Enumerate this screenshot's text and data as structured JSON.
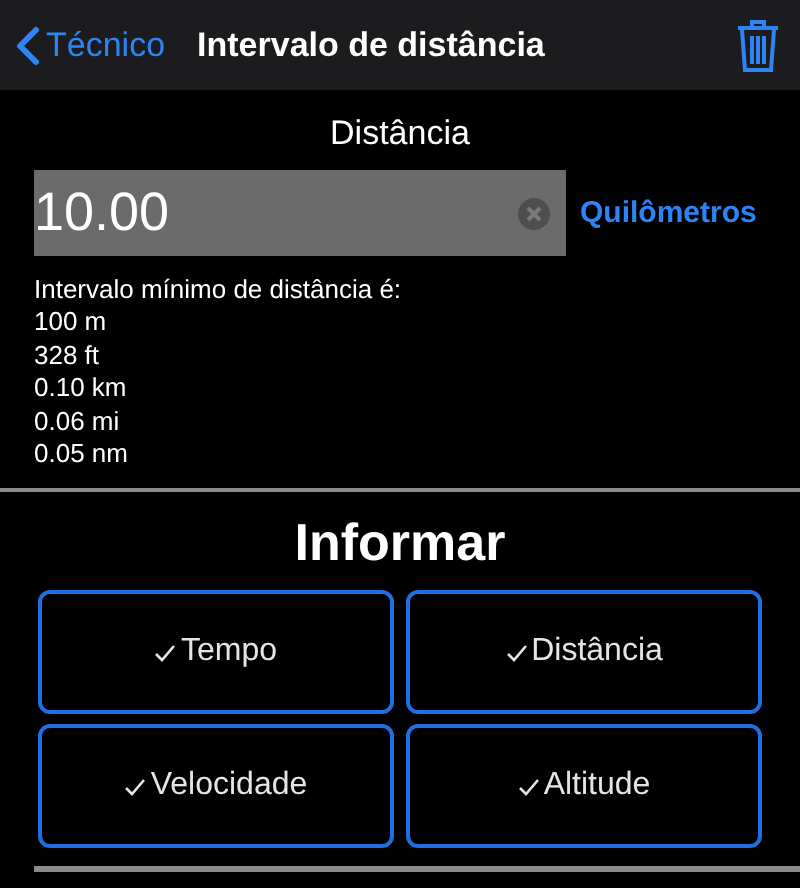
{
  "nav": {
    "back": "Técnico",
    "title": "Intervalo de distância"
  },
  "distance": {
    "heading": "Distância",
    "value": "10.00",
    "unit": "Quilômetros"
  },
  "minimum": {
    "intro": "Intervalo mínimo de distância é:",
    "lines": [
      "100 m",
      "328 ft",
      "0.10 km",
      "0.06 mi",
      "0.05 nm"
    ]
  },
  "report": {
    "heading": "Informar",
    "options": [
      {
        "label": "Tempo",
        "checked": true
      },
      {
        "label": "Distância",
        "checked": true
      },
      {
        "label": "Velocidade",
        "checked": true
      },
      {
        "label": "Altitude",
        "checked": true
      }
    ]
  }
}
